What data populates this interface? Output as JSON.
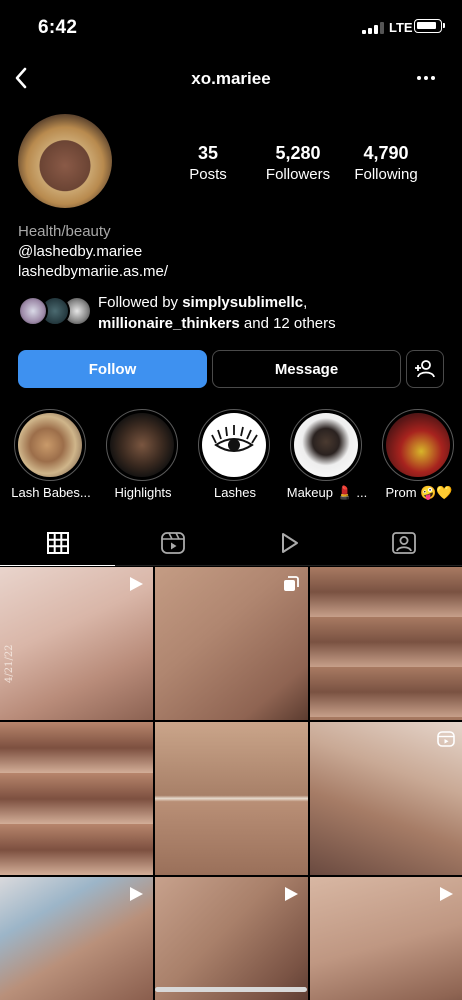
{
  "status_bar": {
    "time": "6:42",
    "network": "LTE"
  },
  "nav": {
    "username": "xo.mariee"
  },
  "profile": {
    "stats": [
      {
        "value": "35",
        "label": "Posts"
      },
      {
        "value": "5,280",
        "label": "Followers"
      },
      {
        "value": "4,790",
        "label": "Following"
      }
    ],
    "category": "Health/beauty",
    "handle": "@lashedby.mariee",
    "link": "lashedbymariie.as.me/"
  },
  "followed_by": {
    "prefix": "Followed by ",
    "user1": "simplysublimellc",
    "comma": ",",
    "user2": "millionaire_thinkers",
    "suffix": " and 12 others"
  },
  "actions": {
    "follow": "Follow",
    "message": "Message"
  },
  "highlights": [
    {
      "label": "Lash Babes..."
    },
    {
      "label": "Highlights"
    },
    {
      "label": "Lashes"
    },
    {
      "label": "Makeup 💄 ..."
    },
    {
      "label": "Prom 🤪💛"
    }
  ],
  "tabs": [
    "grid-icon",
    "reels-icon",
    "play-icon",
    "tagged-icon"
  ],
  "grid_posts": [
    {
      "type": "video",
      "overlay_text": "4/21/22"
    },
    {
      "type": "carousel"
    },
    {
      "type": "image"
    },
    {
      "type": "image"
    },
    {
      "type": "image"
    },
    {
      "type": "reel"
    },
    {
      "type": "video"
    },
    {
      "type": "video"
    },
    {
      "type": "video"
    }
  ],
  "colors": {
    "accent": "#3e91f0",
    "background": "#000000"
  }
}
